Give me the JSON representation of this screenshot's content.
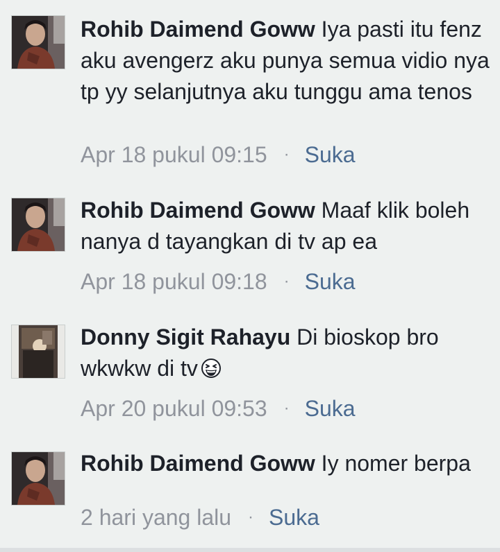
{
  "comments": [
    {
      "author": "Rohib Daimend Goww",
      "text": "Iya pasti itu fenz aku avengerz aku punya semua vidio nya tp yy selanjutnya aku tunggu ama tenos",
      "time": "Apr 18 pukul 09:15",
      "separator": "·",
      "like": "Suka"
    },
    {
      "author": "Rohib Daimend Goww",
      "text": "Maaf klik boleh nanya d tayangkan di tv ap ea",
      "time": "Apr 18 pukul 09:18",
      "separator": "·",
      "like": "Suka"
    },
    {
      "author": "Donny Sigit Rahayu",
      "text": "Di bioskop bro wkwkw di tv",
      "emoji": "grinning-squinting-face-emoji",
      "time": "Apr 20 pukul 09:53",
      "separator": "·",
      "like": "Suka"
    },
    {
      "author": "Rohib Daimend Goww",
      "text": "Iy nomer berpa",
      "time": "2 hari yang lalu",
      "separator": "·",
      "like": "Suka"
    }
  ],
  "colors": {
    "background": "#eef1f0",
    "text": "#1d2129",
    "meta": "#90949c",
    "link": "#4b6b91"
  }
}
